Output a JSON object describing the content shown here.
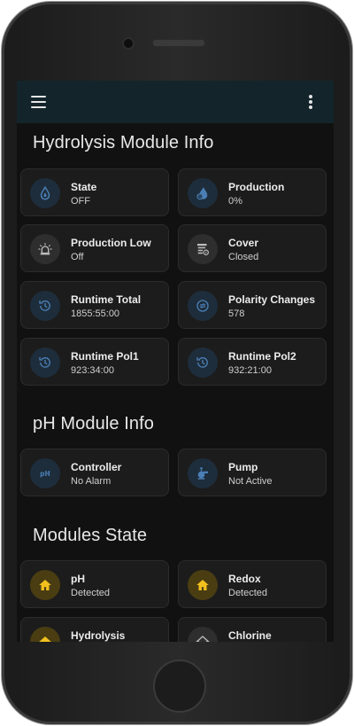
{
  "colors": {
    "topbar": "#13252b",
    "background": "#111111",
    "card": "#1c1c1c",
    "icon_blue": "#4a7fb5",
    "icon_amber": "#f2c01e"
  },
  "sections": {
    "hydrolysis": {
      "title": "Hydrolysis Module Info",
      "cards": [
        {
          "name": "State",
          "value": "OFF",
          "icon": "water-drop-icon"
        },
        {
          "name": "Production",
          "value": "0%",
          "icon": "water-percent-icon"
        },
        {
          "name": "Production Low",
          "value": "Off",
          "icon": "alarm-light-icon"
        },
        {
          "name": "Cover",
          "value": "Closed",
          "icon": "pool-cover-icon"
        },
        {
          "name": "Runtime Total",
          "value": "1855:55:00",
          "icon": "history-icon"
        },
        {
          "name": "Polarity Changes",
          "value": "578",
          "icon": "swap-circle-icon"
        },
        {
          "name": "Runtime Pol1",
          "value": "923:34:00",
          "icon": "history-icon"
        },
        {
          "name": "Runtime Pol2",
          "value": "932:21:00",
          "icon": "history-icon"
        }
      ]
    },
    "ph": {
      "title": "pH Module Info",
      "cards": [
        {
          "name": "Controller",
          "value": "No Alarm",
          "icon": "ph-icon"
        },
        {
          "name": "Pump",
          "value": "Not Active",
          "icon": "pump-icon"
        }
      ]
    },
    "modules": {
      "title": "Modules State",
      "cards": [
        {
          "name": "pH",
          "value": "Detected",
          "icon": "home-icon"
        },
        {
          "name": "Redox",
          "value": "Detected",
          "icon": "home-icon"
        },
        {
          "name": "Hydrolysis",
          "value": "",
          "icon": "home-icon"
        },
        {
          "name": "Chlorine",
          "value": "",
          "icon": "home-outline-icon"
        }
      ]
    }
  }
}
